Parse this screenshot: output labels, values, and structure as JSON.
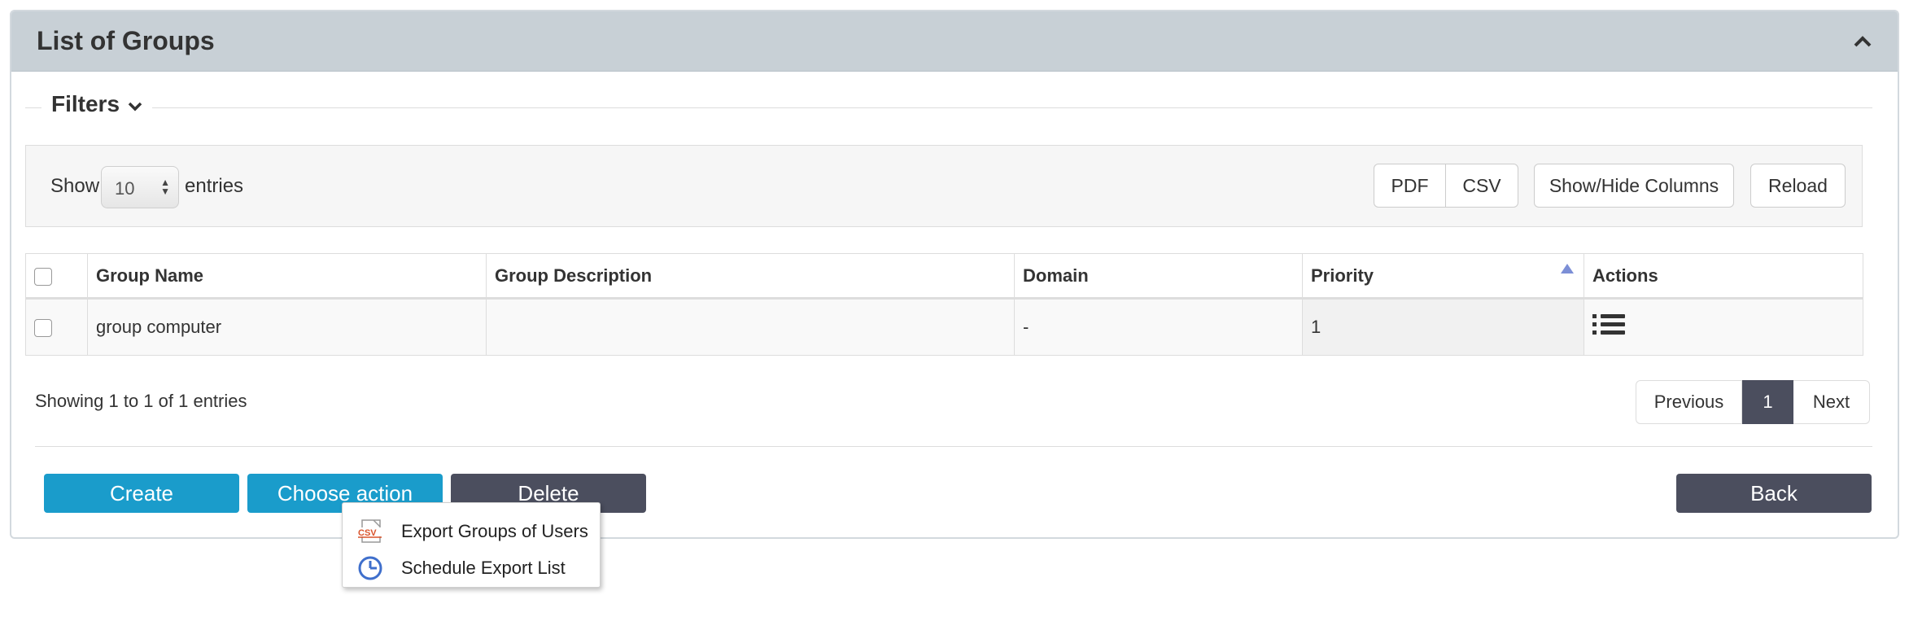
{
  "panel": {
    "title": "List of Groups",
    "collapse_icon": "chevron-up-icon"
  },
  "filters": {
    "label": "Filters",
    "toggle_icon": "chevron-down-icon"
  },
  "toolbar": {
    "show_label": "Show",
    "entries_label": "entries",
    "page_length": "10",
    "buttons": {
      "pdf": "PDF",
      "csv": "CSV",
      "show_hide_columns": "Show/Hide Columns",
      "reload": "Reload"
    }
  },
  "table": {
    "columns": [
      "",
      "Group Name",
      "Group Description",
      "Domain",
      "Priority",
      "Actions"
    ],
    "sort_column": "Priority",
    "sort_direction": "ascending",
    "rows": [
      {
        "group_name": "group computer",
        "group_description": "",
        "domain": "-",
        "priority": "1",
        "actions_icon": "list-menu-icon"
      }
    ]
  },
  "info": "Showing 1 to 1 of 1 entries",
  "pagination": {
    "previous": "Previous",
    "current": "1",
    "next": "Next"
  },
  "actions": {
    "create": "Create",
    "choose_action": "Choose action",
    "delete": "Delete",
    "back": "Back"
  },
  "dropdown": {
    "items": [
      {
        "label": "Export Groups of Users",
        "icon": "csv-file-icon"
      },
      {
        "label": "Schedule Export List",
        "icon": "clock-icon"
      }
    ]
  },
  "colors": {
    "header_bg": "#c8d0d6",
    "primary_blue": "#1a9ccb",
    "dark_button": "#4b4e5e",
    "sort_arrow": "#7c8fd6"
  }
}
